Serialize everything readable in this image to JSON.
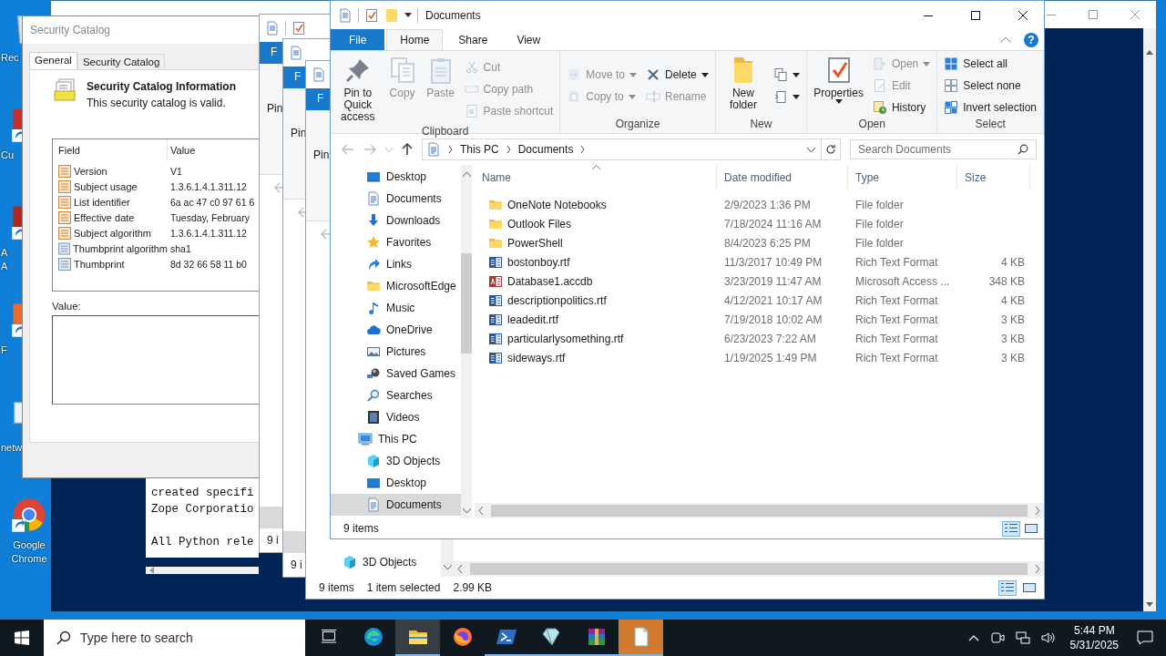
{
  "desktop": {
    "icons": [
      {
        "kind": "recycle",
        "lines": [
          "Rec"
        ]
      },
      {
        "kind": "shortcut",
        "lines": [
          "Cu"
        ]
      },
      {
        "kind": "shortcut",
        "lines": [
          "A",
          "A"
        ]
      },
      {
        "kind": "shortcut",
        "lines": [
          "F"
        ]
      },
      {
        "kind": "network",
        "lines": [
          "netw"
        ]
      },
      {
        "kind": "browser",
        "lines": [
          "Google",
          "Chrome"
        ]
      }
    ]
  },
  "powershell": {
    "text_panel": {
      "paragraphs": [
        [
          "created specifi",
          "Zope Corporatio"
        ],
        [
          "All Python rele"
        ]
      ]
    }
  },
  "security_catalog": {
    "title": "Security Catalog",
    "tabs": [
      {
        "label": "General",
        "selected": true
      },
      {
        "label": "Security Catalog",
        "selected": false
      }
    ],
    "heading": "Security Catalog Information",
    "status": "This security catalog is valid.",
    "columns": [
      "Field",
      "Value"
    ],
    "rows": [
      {
        "kind": "attribute",
        "field": "Version",
        "value": "V1"
      },
      {
        "kind": "attribute",
        "field": "Subject usage",
        "value": "1.3.6.1.4.1.311.12"
      },
      {
        "kind": "attribute",
        "field": "List identifier",
        "value": "6a ac 47 c0 97 61 6"
      },
      {
        "kind": "attribute",
        "field": "Effective date",
        "value": "Tuesday, February"
      },
      {
        "kind": "attribute",
        "field": "Subject algorithm",
        "value": "1.3.6.1.4.1.311.12"
      },
      {
        "kind": "property",
        "field": "Thumbprint algorithm",
        "value": "sha1"
      },
      {
        "kind": "property",
        "field": "Thumbprint",
        "value": "8d 32 66 58 11 b0"
      }
    ],
    "value_label": "Value:"
  },
  "background_explorers": [
    {
      "file_tab": "F",
      "pin_label": "Pin",
      "status": "9 i"
    },
    {
      "file_tab": "F",
      "pin_label": "Pin",
      "status": "9 i"
    }
  ],
  "explorer_behind": {
    "file_tab": "F",
    "pin_label": "Pin",
    "nav_items": [
      {
        "label": "3D Objects",
        "kind": "objects3d"
      }
    ],
    "status": {
      "count": "9 items",
      "selection": "1 item selected",
      "size": "2.99 KB"
    }
  },
  "explorer": {
    "title": "Documents",
    "tabs": [
      {
        "label": "File",
        "kind": "file",
        "selected": false
      },
      {
        "label": "Home",
        "kind": "tab",
        "selected": true
      },
      {
        "label": "Share",
        "kind": "tab",
        "selected": false
      },
      {
        "label": "View",
        "kind": "tab",
        "selected": false
      }
    ],
    "help": "?",
    "ribbon": [
      {
        "label": "Clipboard",
        "columns": [
          {
            "kind": "large",
            "buttons": [
              {
                "label": "Pin to Quick access",
                "disabled": false
              }
            ]
          },
          {
            "kind": "large",
            "buttons": [
              {
                "label": "Copy",
                "disabled": true
              }
            ]
          },
          {
            "kind": "large",
            "buttons": [
              {
                "label": "Paste",
                "disabled": true
              }
            ]
          },
          {
            "kind": "small",
            "buttons": [
              {
                "label": "Cut",
                "disabled": true
              },
              {
                "label": "Copy path",
                "disabled": true
              },
              {
                "label": "Paste shortcut",
                "disabled": true
              }
            ]
          }
        ]
      },
      {
        "label": "Organize",
        "columns": [
          {
            "kind": "small",
            "buttons": [
              {
                "label": "Move to",
                "disabled": true,
                "dropdown": true
              },
              {
                "label": "Copy to",
                "disabled": true,
                "dropdown": true
              }
            ]
          },
          {
            "kind": "small",
            "buttons": [
              {
                "label": "Delete",
                "disabled": false,
                "dropdown": true
              },
              {
                "label": "Rename",
                "disabled": true
              }
            ]
          }
        ]
      },
      {
        "label": "New",
        "columns": [
          {
            "kind": "large",
            "buttons": [
              {
                "label": "New folder",
                "disabled": false
              }
            ]
          },
          {
            "kind": "small",
            "buttons": [
              {
                "disabled": false,
                "dropdown": true
              },
              {
                "disabled": false,
                "dropdown": true
              }
            ]
          }
        ]
      },
      {
        "label": "Open",
        "columns": [
          {
            "kind": "large",
            "buttons": [
              {
                "label": "Properties",
                "disabled": false,
                "dropdown": true
              }
            ]
          },
          {
            "kind": "small",
            "buttons": [
              {
                "label": "Open",
                "disabled": true,
                "dropdown": true
              },
              {
                "label": "Edit",
                "disabled": true
              },
              {
                "label": "History",
                "disabled": false
              }
            ]
          }
        ]
      },
      {
        "label": "Select",
        "columns": [
          {
            "kind": "small",
            "buttons": [
              {
                "label": "Select all",
                "disabled": false
              },
              {
                "label": "Select none",
                "disabled": false
              },
              {
                "label": "Invert selection",
                "disabled": false
              }
            ]
          }
        ]
      }
    ],
    "address": {
      "segments": [
        "This PC",
        "Documents"
      ]
    },
    "search": {
      "placeholder": "Search Documents"
    },
    "nav_pane": {
      "scrolled_children": [
        {
          "label": "Desktop",
          "kind": "desktop",
          "selected": false
        },
        {
          "label": "Documents",
          "kind": "documents",
          "selected": false
        },
        {
          "label": "Downloads",
          "kind": "downloads",
          "selected": false
        },
        {
          "label": "Favorites",
          "kind": "favorites",
          "selected": false
        },
        {
          "label": "Links",
          "kind": "links",
          "selected": false
        },
        {
          "label": "MicrosoftEdge",
          "kind": "folder",
          "selected": false
        },
        {
          "label": "Music",
          "kind": "music",
          "selected": false
        },
        {
          "label": "OneDrive",
          "kind": "onedrive",
          "selected": false
        },
        {
          "label": "Pictures",
          "kind": "pictures",
          "selected": false
        },
        {
          "label": "Saved Games",
          "kind": "games",
          "selected": false
        },
        {
          "label": "Searches",
          "kind": "searches",
          "selected": false
        },
        {
          "label": "Videos",
          "kind": "videos",
          "selected": false
        }
      ],
      "items": [
        {
          "label": "This PC",
          "kind": "pc",
          "selected": false,
          "children": [
            {
              "label": "3D Objects",
              "kind": "objects3d",
              "selected": false
            },
            {
              "label": "Desktop",
              "kind": "desktop",
              "selected": false
            },
            {
              "label": "Documents",
              "kind": "documents",
              "selected": true
            }
          ]
        }
      ]
    },
    "file_list": {
      "columns": [
        {
          "label": "Name",
          "sorted": true
        },
        {
          "label": "Date modified",
          "sorted": false
        },
        {
          "label": "Type",
          "sorted": false
        },
        {
          "label": "Size",
          "sorted": false
        }
      ],
      "rows": [
        {
          "kind": "folder",
          "name": "OneNote Notebooks",
          "date": "2/9/2023 1:36 PM",
          "type": "File folder"
        },
        {
          "kind": "folder",
          "name": "Outlook Files",
          "date": "7/18/2024 11:16 AM",
          "type": "File folder"
        },
        {
          "kind": "folder",
          "name": "PowerShell",
          "date": "8/4/2023 6:25 PM",
          "type": "File folder"
        },
        {
          "kind": "rtf",
          "name": "bostonboy.rtf",
          "date": "11/3/2017 10:49 PM",
          "type": "Rich Text Format",
          "size": "4 KB"
        },
        {
          "kind": "access",
          "name": "Database1.accdb",
          "date": "3/23/2019 11:47 AM",
          "type": "Microsoft Access ...",
          "size": "348 KB"
        },
        {
          "kind": "rtf",
          "name": "descriptionpolitics.rtf",
          "date": "4/12/2021 10:17 AM",
          "type": "Rich Text Format",
          "size": "4 KB"
        },
        {
          "kind": "rtf",
          "name": "leadedit.rtf",
          "date": "7/19/2018 10:02 AM",
          "type": "Rich Text Format",
          "size": "3 KB"
        },
        {
          "kind": "rtf",
          "name": "particularlysomething.rtf",
          "date": "6/23/2023 7:22 AM",
          "type": "Rich Text Format",
          "size": "3 KB"
        },
        {
          "kind": "rtf",
          "name": "sideways.rtf",
          "date": "1/19/2025 1:49 PM",
          "type": "Rich Text Format",
          "size": "3 KB"
        }
      ]
    },
    "status_bar": {
      "count": "9 items"
    },
    "view_modes": [
      {
        "kind": "details",
        "selected": true
      },
      {
        "kind": "large-icons",
        "selected": false
      }
    ]
  },
  "taskbar": {
    "search_placeholder": "Type here to search",
    "apps": [
      {
        "kind": "edge",
        "running": false,
        "selected": false,
        "flashing": false
      },
      {
        "kind": "folder",
        "running": true,
        "selected": true,
        "flashing": false
      },
      {
        "kind": "firefox",
        "running": false,
        "selected": false,
        "flashing": false
      },
      {
        "kind": "terminal",
        "running": true,
        "selected": false,
        "flashing": false
      },
      {
        "kind": "crystal",
        "running": true,
        "selected": false,
        "flashing": false
      },
      {
        "kind": "archive",
        "running": true,
        "selected": false,
        "flashing": false
      },
      {
        "kind": "document",
        "running": true,
        "selected": false,
        "flashing": true
      }
    ],
    "clock": {
      "time": "5:44 PM",
      "date": "5/31/2025"
    }
  }
}
